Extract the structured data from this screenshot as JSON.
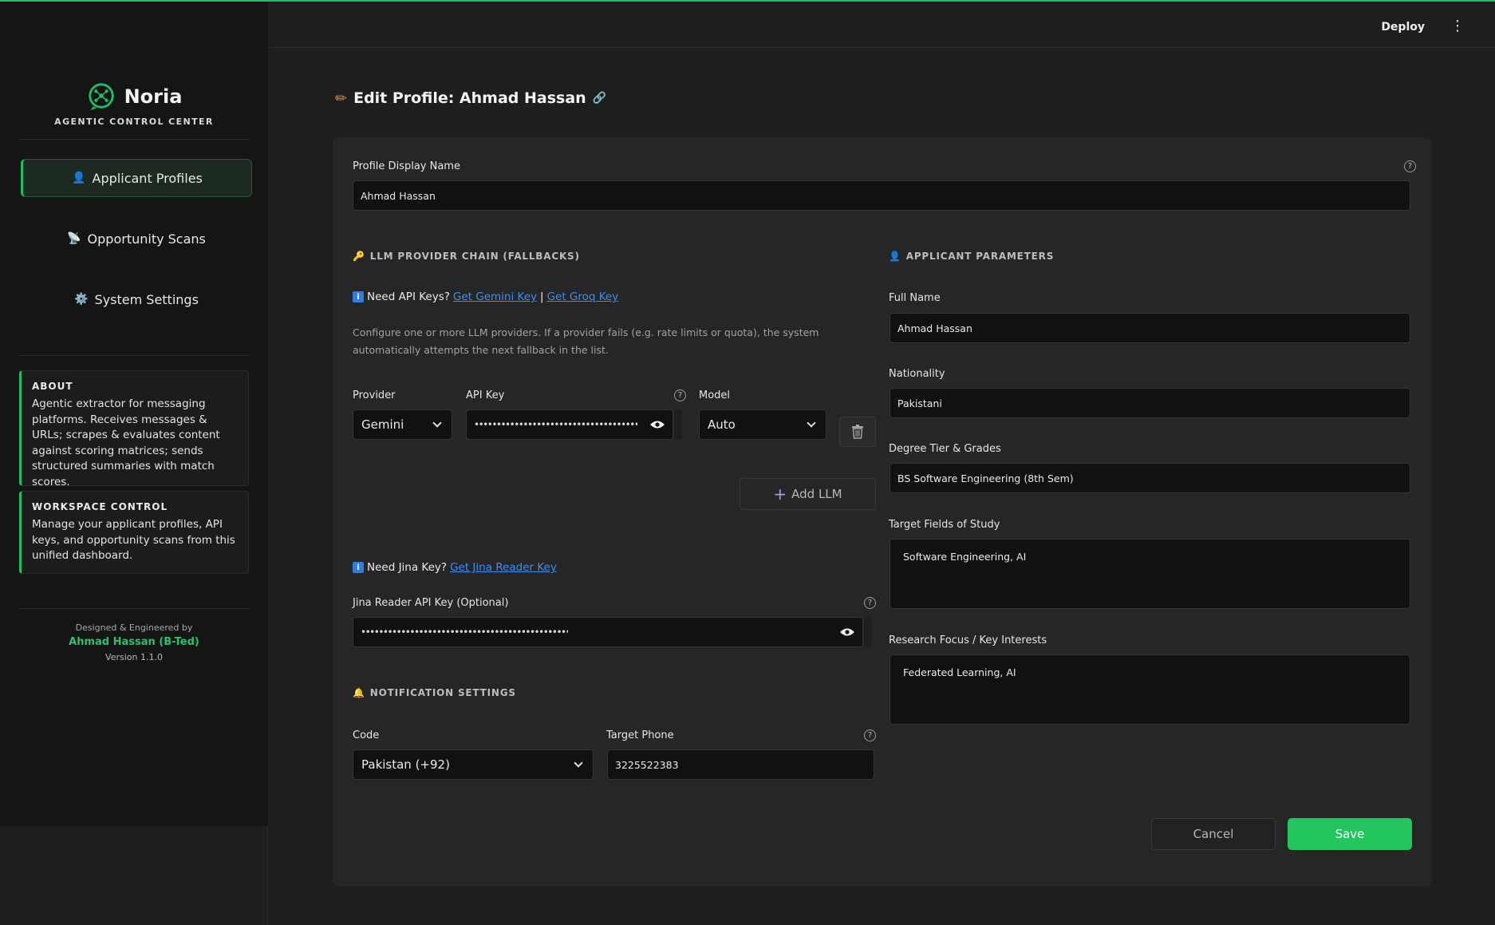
{
  "app": {
    "brand_name": "Noria",
    "brand_subtitle": "AGENTIC CONTROL CENTER",
    "accent_color": "#1fbf63"
  },
  "header": {
    "deploy_label": "Deploy",
    "menu_icon": "kebab-menu-icon"
  },
  "sidebar": {
    "items": [
      {
        "icon": "👤",
        "label": "Applicant Profiles",
        "active": true
      },
      {
        "icon": "📡",
        "label": "Opportunity Scans",
        "active": false
      },
      {
        "icon": "⚙️",
        "label": "System Settings",
        "active": false
      }
    ],
    "about": {
      "title": "ABOUT",
      "text": "Agentic extractor for messaging platforms. Receives messages & URLs; scrapes & evaluates content against scoring matrices; sends structured summaries with match scores."
    },
    "workspace": {
      "title": "WORKSPACE CONTROL",
      "text": "Manage your applicant profiles, API keys, and opportunity scans from this unified dashboard."
    },
    "credit": {
      "line1": "Designed & Engineered by",
      "author": "Ahmad Hassan (B-Ted)",
      "version": "Version 1.1.0"
    }
  },
  "page": {
    "title": "Edit Profile: Ahmad Hassan"
  },
  "form": {
    "display_name_label": "Profile Display Name",
    "display_name_value": "Ahmad Hassan",
    "llm": {
      "section_title": "LLM PROVIDER CHAIN (FALLBACKS)",
      "info_prefix": "Need API Keys?",
      "gemini_link": "Get Gemini Key",
      "separator": "|",
      "groq_link": "Get Groq Key",
      "description": "Configure one or more LLM providers. If a provider fails (e.g. rate limits or quota), the system automatically attempts the next fallback in the list.",
      "provider_label": "Provider",
      "provider_value": "Gemini",
      "api_key_label": "API Key",
      "api_key_masked": "•••••••••••••••••••••••••••••••••••••••••••••••••••••••",
      "model_label": "Model",
      "model_value": "Auto",
      "add_llm_label": "Add LLM"
    },
    "jina": {
      "info_prefix": "Need Jina Key?",
      "link": "Get Jina Reader Key",
      "label": "Jina Reader API Key (Optional)",
      "masked": "•••••••••••••••••••••••••••••••••••••••••••••••••••••••••••••••••••••••"
    },
    "notification": {
      "section_title": "NOTIFICATION SETTINGS",
      "code_label": "Code",
      "code_value": "Pakistan (+92)",
      "phone_label": "Target Phone",
      "phone_value": "3225522383"
    },
    "applicant": {
      "section_title": "APPLICANT PARAMETERS",
      "full_name_label": "Full Name",
      "full_name_value": "Ahmad Hassan",
      "nationality_label": "Nationality",
      "nationality_value": "Pakistani",
      "degree_label": "Degree Tier & Grades",
      "degree_value": "BS Software Engineering (8th Sem)",
      "fields_label": "Target Fields of Study",
      "fields_value": "Software Engineering, AI",
      "research_label": "Research Focus / Key Interests",
      "research_value": "Federated Learning, AI"
    },
    "actions": {
      "cancel_label": "Cancel",
      "save_label": "Save"
    }
  }
}
